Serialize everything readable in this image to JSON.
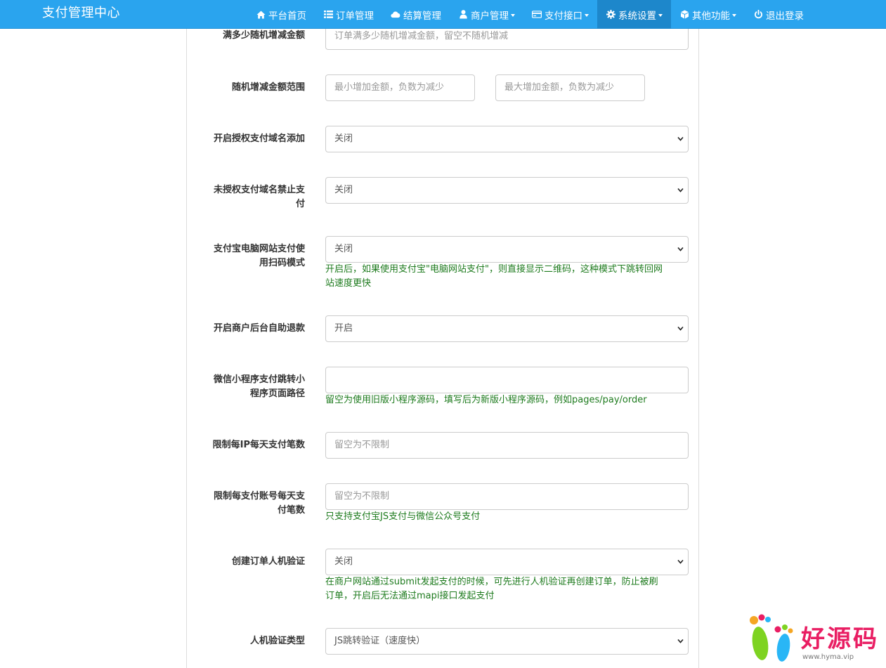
{
  "navbar": {
    "brand": "支付管理中心",
    "items": [
      {
        "label": "平台首页",
        "icon": "home-icon",
        "dropdown": false
      },
      {
        "label": "订单管理",
        "icon": "list-icon",
        "dropdown": false
      },
      {
        "label": "结算管理",
        "icon": "cloud-icon",
        "dropdown": false
      },
      {
        "label": "商户管理",
        "icon": "user-icon",
        "dropdown": true
      },
      {
        "label": "支付接口",
        "icon": "credit-card-icon",
        "dropdown": true
      },
      {
        "label": "系统设置",
        "icon": "gear-icon",
        "dropdown": true,
        "active": true
      },
      {
        "label": "其他功能",
        "icon": "cube-icon",
        "dropdown": true
      },
      {
        "label": "退出登录",
        "icon": "power-icon",
        "dropdown": false
      }
    ]
  },
  "form": {
    "random_amount": {
      "label": "满多少随机增减金额",
      "placeholder": "订单满多少随机增减金额，留空不随机增减"
    },
    "random_range": {
      "label": "随机增减金额范围",
      "min_placeholder": "最小增加金额，负数为减少",
      "max_placeholder": "最大增加金额，负数为减少"
    },
    "auth_domain_add": {
      "label": "开启授权支付域名添加",
      "value": "关闭"
    },
    "unauth_domain_forbid": {
      "label_line1": "未授权支付域名禁止支",
      "label_line2": "付",
      "value": "关闭"
    },
    "alipay_qr_mode": {
      "label_line1": "支付宝电脑网站支付使",
      "label_line2": "用扫码模式",
      "value": "关闭",
      "help_line1": "开启后，如果使用支付宝\"电脑网站支付\"，则直接显示二维码，这种模式下跳转回网",
      "help_line2": "站速度更快"
    },
    "merchant_refund": {
      "label": "开启商户后台自助退款",
      "value": "开启"
    },
    "wx_miniprogram_path": {
      "label_line1": "微信小程序支付跳转小",
      "label_line2": "程序页面路径",
      "value": "",
      "help": "留空为使用旧版小程序源码，填写后为新版小程序源码，例如pages/pay/order"
    },
    "ip_daily_limit": {
      "label": "限制每IP每天支付笔数",
      "placeholder": "留空为不限制"
    },
    "account_daily_limit": {
      "label_line1": "限制每支付账号每天支",
      "label_line2": "付笔数",
      "placeholder": "留空为不限制",
      "help": "只支持支付宝JS支付与微信公众号支付"
    },
    "captcha": {
      "label": "创建订单人机验证",
      "value": "关闭",
      "help_line1": "在商户网站通过submit发起支付的时候，可先进行人机验证再创建订单，防止被刷",
      "help_line2": "订单，开启后无法通过mapi接口发起支付"
    },
    "captcha_type": {
      "label": "人机验证类型",
      "value": "JS跳转验证（速度快）"
    }
  },
  "watermark": {
    "text": "好源码",
    "url": "www.hyma.vip"
  }
}
